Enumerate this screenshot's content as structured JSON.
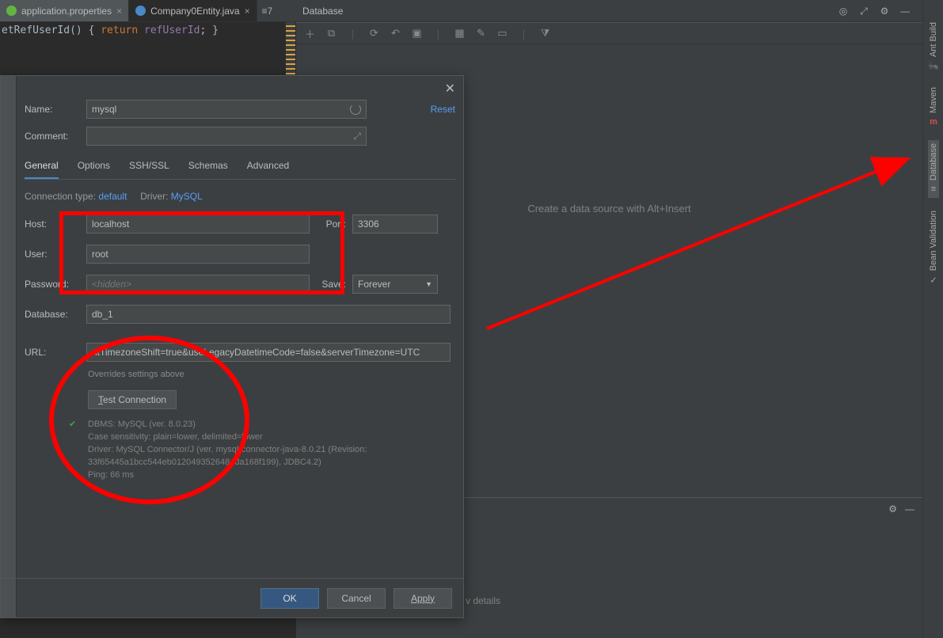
{
  "tabs": {
    "appProps": "application.properties",
    "companyEntity": "Company0Entity.java",
    "tool": "≡7"
  },
  "code": {
    "func_decl": "etRefUserId()",
    "brace_open": "{",
    "return_kw": "return",
    "return_id": "refUserId",
    "semi": ";",
    "brace_close": "}"
  },
  "rail": {
    "antBuild": "Ant Build",
    "maven": "Maven",
    "database": "Database",
    "beanValidation": "Bean Validation"
  },
  "db": {
    "title": "Database",
    "placeholder": "Create a data source with Alt+Insert"
  },
  "dialog": {
    "name_lbl": "Name:",
    "name_val": "mysql",
    "reset": "Reset",
    "comment_lbl": "Comment:",
    "tabs": {
      "general": "General",
      "options": "Options",
      "sshssl": "SSH/SSL",
      "schemas": "Schemas",
      "advanced": "Advanced"
    },
    "conn_type_lbl": "Connection type:",
    "conn_type_val": "default",
    "driver_lbl": "Driver:",
    "driver_val": "MySQL",
    "host_lbl": "Host:",
    "host_val": "localhost",
    "port_lbl": "Port:",
    "port_val": "3306",
    "user_lbl": "User:",
    "user_val": "root",
    "password_lbl": "Password:",
    "password_placeholder": "<hidden>",
    "save_lbl": "Save:",
    "save_val": "Forever",
    "database_lbl": "Database:",
    "database_val": "db_1",
    "url_lbl": "URL:",
    "url_val": "ntTimezoneShift=true&useLegacyDatetimeCode=false&serverTimezone=UTC",
    "overrides": "Overrides settings above",
    "test_btn": "Test Connection",
    "status_line1": "DBMS: MySQL (ver. 8.0.23)",
    "status_line2": "Case sensitivity: plain=lower, delimited=lower",
    "status_line3": "Driver: MySQL Connector/J (ver. mysql-connector-java-8.0.21 (Revision:",
    "status_line4": "33f65445a1bcc544eb0120493526484da168f199), JDBC4.2)",
    "status_line5": "Ping: 66 ms",
    "ok": "OK",
    "cancel": "Cancel",
    "apply": "Apply"
  },
  "bottom": {
    "details": "v details"
  }
}
